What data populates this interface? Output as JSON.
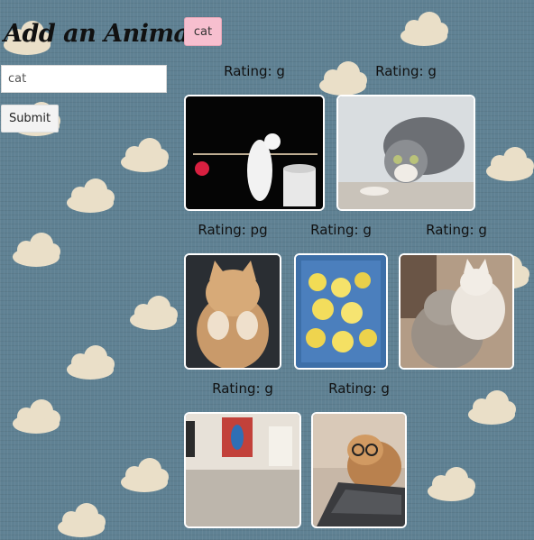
{
  "sidebar": {
    "title": "Add an Animal",
    "input_value": "cat",
    "submit_label": "Submit"
  },
  "chips": [
    "cat"
  ],
  "gifs": [
    {
      "rating_text": "Rating: g",
      "icon": "cat-with-yarn-gif"
    },
    {
      "rating_text": "Rating: g",
      "icon": "tabby-cat-crouching-gif"
    },
    {
      "rating_text": "Rating: pg",
      "icon": "orange-cat-paws-gif"
    },
    {
      "rating_text": "Rating: g",
      "icon": "yellow-chicks-basket-gif"
    },
    {
      "rating_text": "Rating: g",
      "icon": "two-cats-cuddling-gif"
    },
    {
      "rating_text": "Rating: g",
      "icon": "floor-room-gif"
    },
    {
      "rating_text": "Rating: g",
      "icon": "cat-with-glasses-laptop-gif"
    }
  ]
}
